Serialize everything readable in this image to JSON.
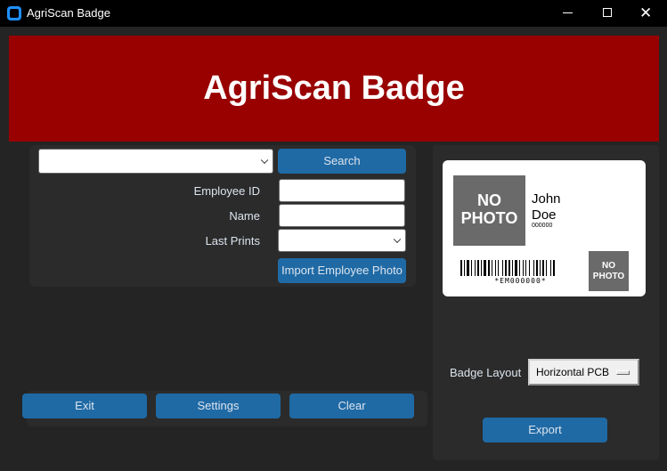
{
  "window": {
    "title": "AgriScan Badge",
    "controls": {
      "minimize": "minimize",
      "maximize": "maximize",
      "close": "✕"
    }
  },
  "banner": {
    "title": "AgriScan Badge"
  },
  "search": {
    "combo_value": "",
    "button_label": "Search"
  },
  "form": {
    "employee_id_label": "Employee ID",
    "employee_id_value": "",
    "name_label": "Name",
    "name_value": "",
    "last_prints_label": "Last Prints",
    "last_prints_value": "",
    "import_photo_label": "Import Employee Photo"
  },
  "actions": {
    "exit_label": "Exit",
    "settings_label": "Settings",
    "clear_label": "Clear"
  },
  "badge": {
    "photo_line1": "NO",
    "photo_line2": "PHOTO",
    "first_name": "John",
    "last_name": "Doe",
    "employee_number": "000000",
    "barcode_text": "*EM000000*",
    "small_photo_line1": "NO",
    "small_photo_line2": "PHOTO"
  },
  "layout": {
    "label": "Badge Layout",
    "selected": "Horizontal PCB"
  },
  "export": {
    "label": "Export"
  },
  "colors": {
    "banner": "#990000",
    "button": "#1f6aa5",
    "panel": "#2b2b2b",
    "background": "#242424"
  }
}
